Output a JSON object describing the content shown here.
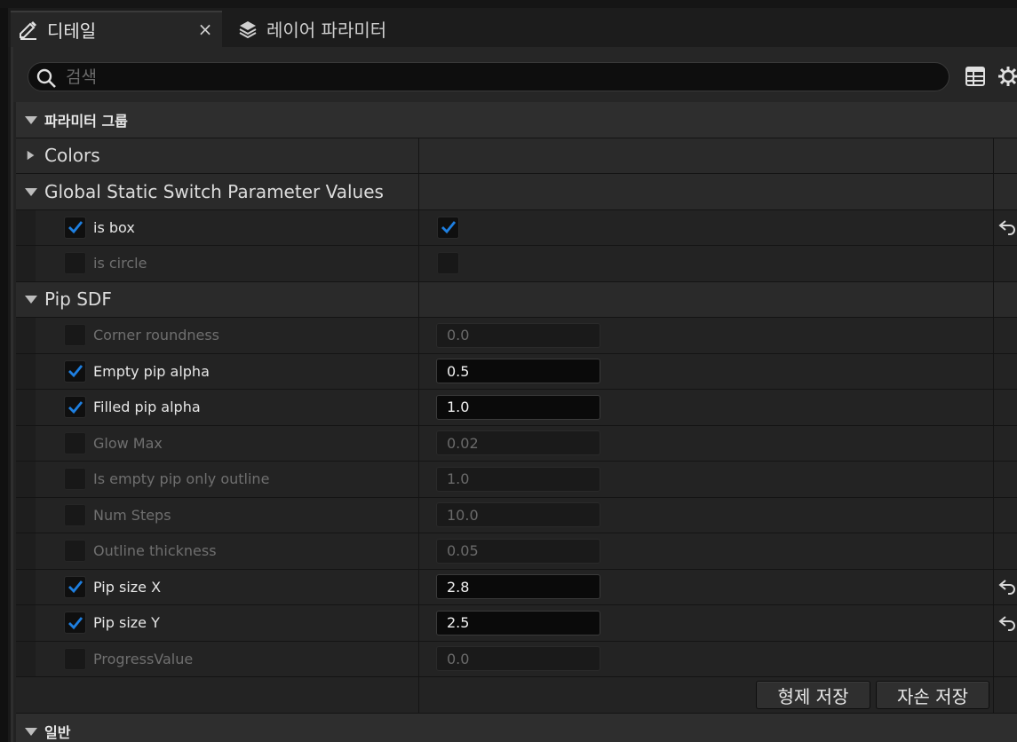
{
  "tabs": [
    {
      "label": "디테일",
      "icon": "pencil-details-icon",
      "active": true,
      "close": "×"
    },
    {
      "label": "레이어 파라미터",
      "icon": "layers-icon",
      "active": false
    }
  ],
  "search": {
    "placeholder": "검색",
    "value": ""
  },
  "toolbar": {
    "icons": [
      "table-view-icon",
      "settings-gear-icon"
    ]
  },
  "group_header": "파라미터 그룹",
  "categories": {
    "colors": "Colors",
    "switches": "Global Static Switch Parameter Values",
    "pip": "Pip SDF"
  },
  "switch_params": [
    {
      "label": "is box",
      "enabled": true,
      "value": true,
      "reset": true
    },
    {
      "label": "is circle",
      "enabled": false,
      "value": false,
      "reset": false
    }
  ],
  "pip_params": [
    {
      "label": "Corner roundness",
      "enabled": false,
      "value": "0.0",
      "reset": false
    },
    {
      "label": "Empty pip alpha",
      "enabled": true,
      "value": "0.5",
      "reset": false
    },
    {
      "label": "Filled pip alpha",
      "enabled": true,
      "value": "1.0",
      "reset": false
    },
    {
      "label": "Glow Max",
      "enabled": false,
      "value": "0.02",
      "reset": false
    },
    {
      "label": "Is empty pip only outline",
      "enabled": false,
      "value": "1.0",
      "reset": false
    },
    {
      "label": "Num Steps",
      "enabled": false,
      "value": "10.0",
      "reset": false
    },
    {
      "label": "Outline thickness",
      "enabled": false,
      "value": "0.05",
      "reset": false
    },
    {
      "label": "Pip size X",
      "enabled": true,
      "value": "2.8",
      "reset": true
    },
    {
      "label": "Pip size Y",
      "enabled": true,
      "value": "2.5",
      "reset": true
    },
    {
      "label": "ProgressValue",
      "enabled": false,
      "value": "0.0",
      "reset": false
    }
  ],
  "buttons": {
    "save_sibling": "형제 저장",
    "save_child": "자손 저장"
  },
  "general_header": "일반",
  "colors": {
    "checkmark": "#1e7fe0",
    "panel": "#222222",
    "group_row": "#2e2e2e"
  }
}
